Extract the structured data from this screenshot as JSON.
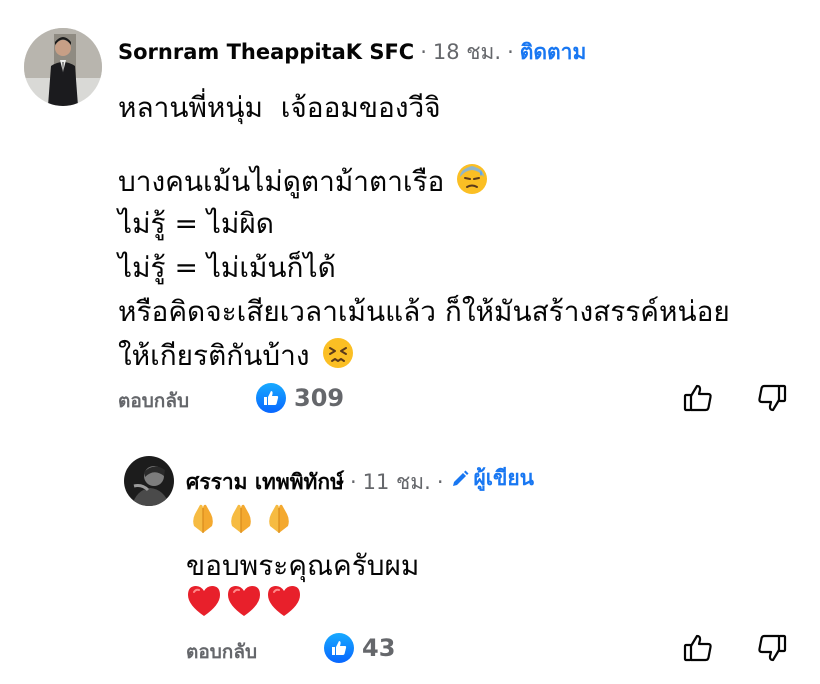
{
  "comment": {
    "author": "Sornram TheappitaK SFC",
    "time": "18 ชม.",
    "follow_label": "ติดตาม",
    "lines": [
      "หลานพี่หนุ่ม  เจ้ออมของวีจิ",
      "บางคนเม้นไม่ดูตาม้าตาเรือ",
      "ไม่รู้ = ไม่ผิด",
      "ไม่รู้ = ไม่เม้นก็ได้",
      "หรือคิดจะเสียเวลาเม้นแล้ว ก็ให้มันสร้างสรรค์หน่อย",
      "ให้เกียรติกันบ้าง"
    ],
    "emojis": {
      "line2": "downcast-sweat-face",
      "line6": "persevering-face"
    },
    "reply_label": "ตอบกลับ",
    "like_count": "309"
  },
  "reply": {
    "author": "ศรราม เทพพิทักษ์",
    "time": "11 ชม.",
    "writer_label": "ผู้เขียน",
    "prayer_emojis": [
      "folded-hands",
      "folded-hands",
      "folded-hands"
    ],
    "text": "ขอบพระคุณครับผม",
    "heart_emojis": [
      "red-heart",
      "red-heart",
      "red-heart"
    ],
    "reply_label": "ตอบกลับ",
    "like_count": "43"
  },
  "separator": "·",
  "colors": {
    "accent": "#1877f2",
    "meta": "#65676b",
    "text": "#050505",
    "heart": "#e8202b",
    "emoji_yellow": "#fbbf24"
  }
}
